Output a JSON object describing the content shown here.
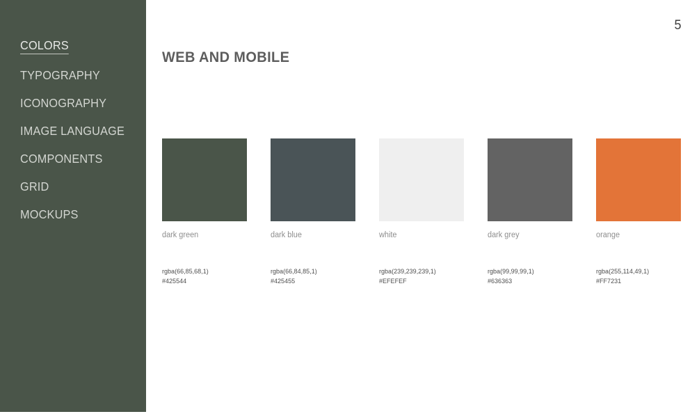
{
  "sidebar": {
    "background_color": "#4a5549",
    "items": [
      {
        "label": "COLORS",
        "active": true
      },
      {
        "label": "TYPOGRAPHY",
        "active": false
      },
      {
        "label": "ICONOGRAPHY",
        "active": false
      },
      {
        "label": "IMAGE LANGUAGE",
        "active": false
      },
      {
        "label": "COMPONENTS",
        "active": false
      },
      {
        "label": "GRID",
        "active": false
      },
      {
        "label": "MOCKUPS",
        "active": false
      }
    ]
  },
  "header": {
    "title": "WEB AND MOBILE",
    "page_number": "5"
  },
  "swatches": [
    {
      "name": "dark green",
      "rgba": "rgba(66,85,68,1)",
      "hex": "#425544",
      "render_color": "#4a5549"
    },
    {
      "name": "dark blue",
      "rgba": "rgba(66,84,85,1)",
      "hex": "#425455",
      "render_color": "#4a5457"
    },
    {
      "name": "white",
      "rgba": "rgba(239,239,239,1)",
      "hex": "#EFEFEF",
      "render_color": "#efefef"
    },
    {
      "name": "dark grey",
      "rgba": "rgba(99,99,99,1)",
      "hex": "#636363",
      "render_color": "#636363"
    },
    {
      "name": "orange",
      "rgba": "rgba(255,114,49,1)",
      "hex": "#FF7231",
      "render_color": "#e37438"
    }
  ]
}
